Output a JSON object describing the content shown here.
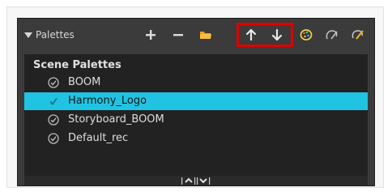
{
  "panel": {
    "title": "Palettes",
    "toolbar": {
      "add_icon": "plus-icon",
      "remove_icon": "minus-icon",
      "folder_icon": "folder-icon",
      "move_up_icon": "arrow-up-icon",
      "move_down_icon": "arrow-down-icon",
      "color_palette_icon": "palette-icon",
      "pencil_palette_icon": "pencil-palette-icon",
      "paint_palette_icon": "paint-palette-icon",
      "highlight_color": "#e00000"
    },
    "list": {
      "group_header": "Scene Palettes",
      "items": [
        {
          "label": "BOOM",
          "selected": false
        },
        {
          "label": "Harmony_Logo",
          "selected": true
        },
        {
          "label": "Storyboard_BOOM",
          "selected": false
        },
        {
          "label": "Default_rec",
          "selected": false
        }
      ],
      "selection_color": "#20c4e2"
    },
    "scroll_handle_icon": "grip-up-down-icon"
  }
}
